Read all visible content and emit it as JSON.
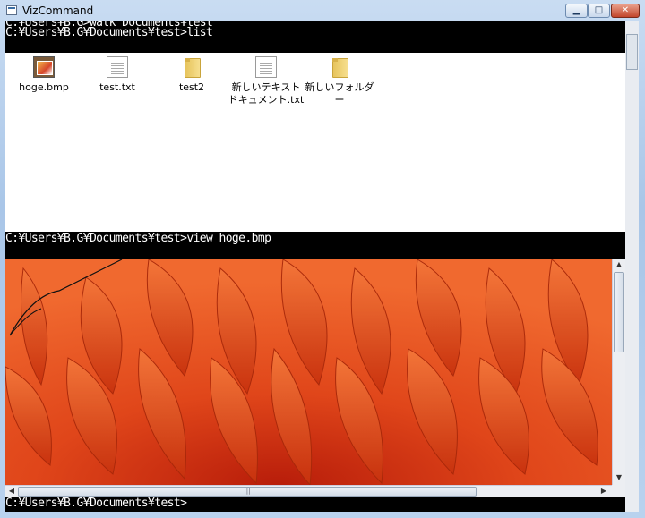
{
  "window": {
    "title": "VizCommand",
    "minimize": "▁",
    "maximize": "□",
    "close": "✕"
  },
  "console": {
    "line0": "C:¥Users¥B.G>walk Documents¥test",
    "line1": "C:¥Users¥B.G¥Documents¥test>list",
    "line2": "C:¥Users¥B.G¥Documents¥test>view hoge.bmp",
    "line3": "C:¥Users¥B.G¥Documents¥test>"
  },
  "files": [
    {
      "name": "hoge.bmp",
      "icon": "bitmap-icon"
    },
    {
      "name": "test.txt",
      "icon": "text-file-icon"
    },
    {
      "name": "test2",
      "icon": "folder-icon"
    },
    {
      "name": "新しいテキスト ドキュメント.txt",
      "icon": "text-file-icon"
    },
    {
      "name": "新しいフォルダー",
      "icon": "folder-icon"
    }
  ],
  "viewer": {
    "image": "orange-flower-photo"
  },
  "colors": {
    "console_bg": "#000000",
    "console_fg": "#ffffff",
    "flower": "#e2541e"
  }
}
